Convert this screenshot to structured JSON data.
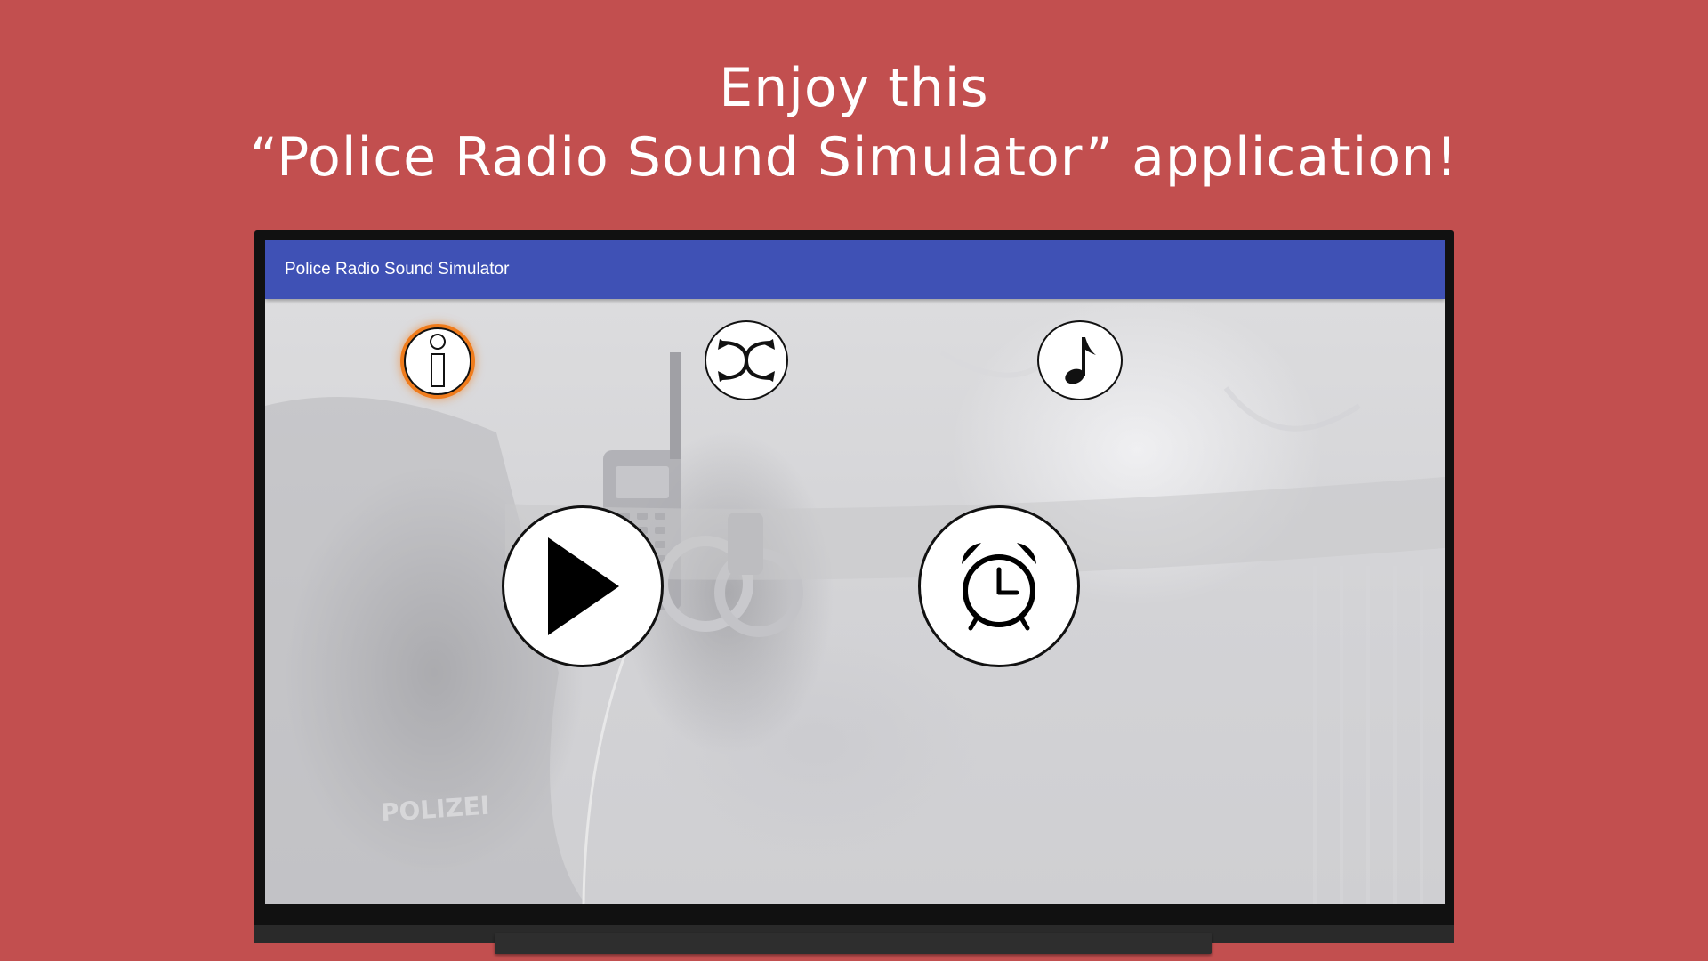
{
  "headline": {
    "line1": "Enjoy this",
    "line2": "“Police Radio Sound Simulator” application!"
  },
  "app": {
    "title": "Police Radio Sound Simulator",
    "appbar_color": "#3f51b5",
    "background_color": "#c24f4f",
    "highlight_color": "#f07c1c"
  },
  "buttons": {
    "info": {
      "icon": "info-icon"
    },
    "shuffle": {
      "icon": "shuffle-icon"
    },
    "music": {
      "icon": "music-note-icon"
    },
    "play": {
      "icon": "play-icon"
    },
    "alarm": {
      "icon": "alarm-clock-icon"
    }
  },
  "background_text": "POLIZEI"
}
